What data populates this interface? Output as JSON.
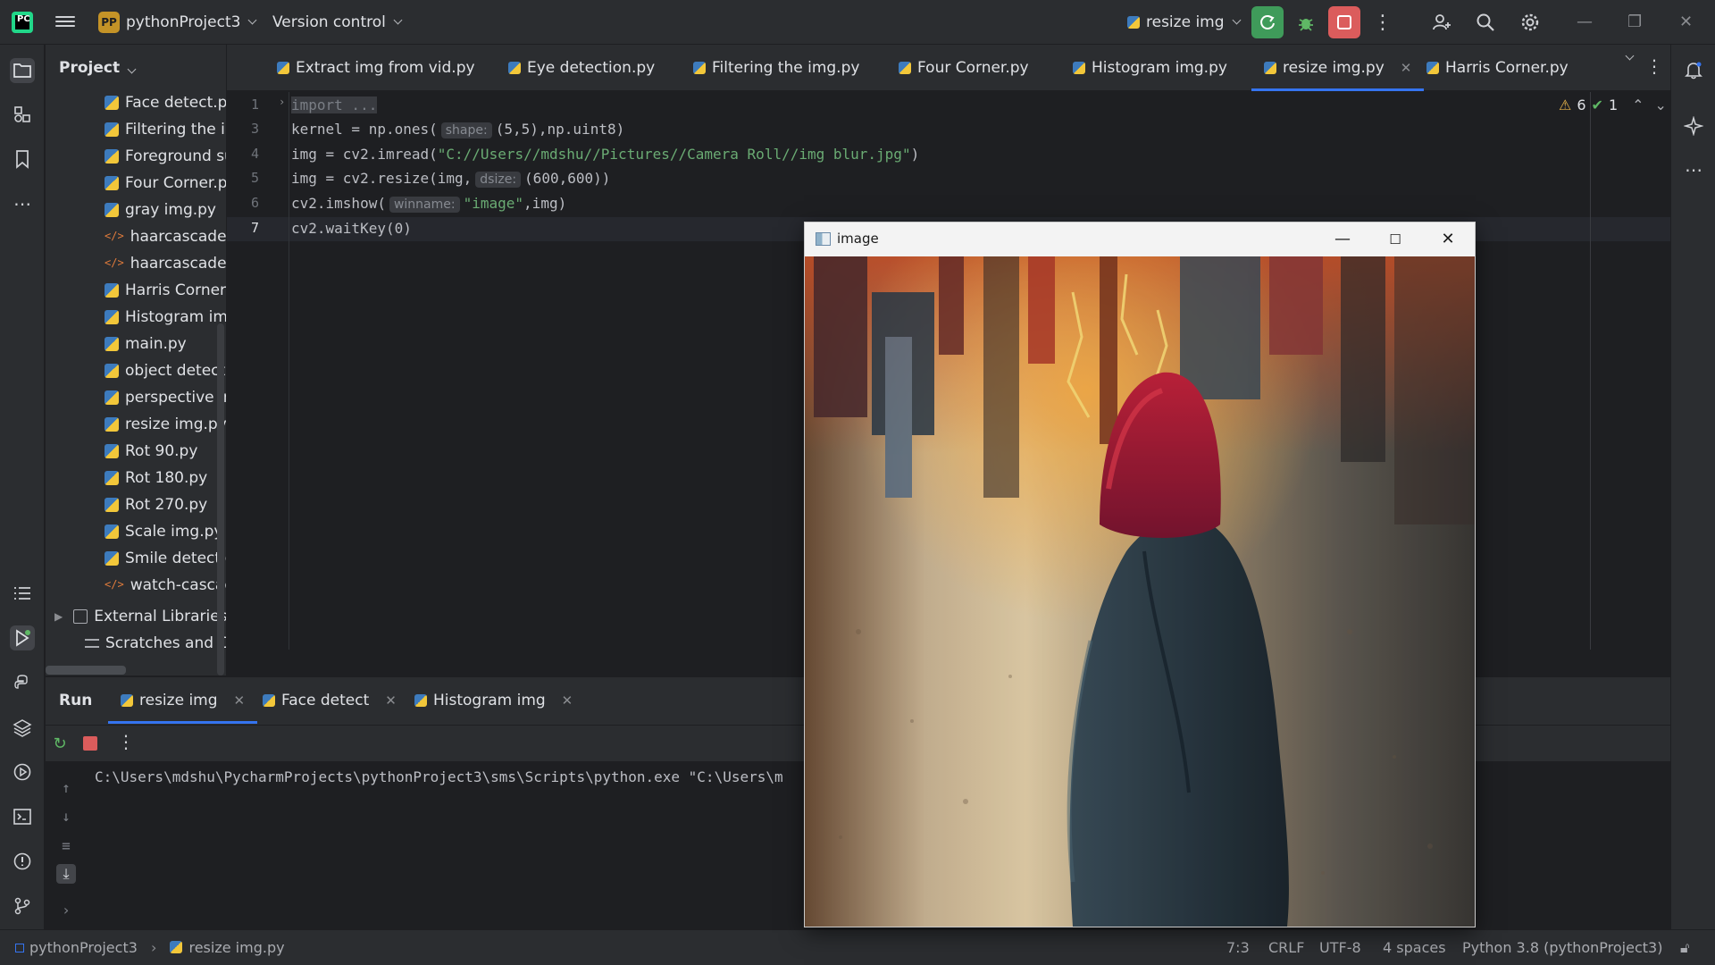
{
  "titlebar": {
    "logo_letters": "PC",
    "project_badge": "PP",
    "project_name": "pythonProject3",
    "vcs_label": "Version control",
    "run_config": "resize img"
  },
  "project_panel": {
    "header": "Project",
    "items": [
      {
        "label": "Face detect.py",
        "type": "py"
      },
      {
        "label": "Filtering the im",
        "type": "py"
      },
      {
        "label": "Foreground su",
        "type": "py"
      },
      {
        "label": "Four Corner.py",
        "type": "py"
      },
      {
        "label": "gray img.py",
        "type": "py"
      },
      {
        "label": "haarcascade_fr",
        "type": "xml"
      },
      {
        "label": "haarcascade_s",
        "type": "xml"
      },
      {
        "label": "Harris Corner.p",
        "type": "py"
      },
      {
        "label": "Histogram img",
        "type": "py"
      },
      {
        "label": "main.py",
        "type": "py"
      },
      {
        "label": "object detect.p",
        "type": "py"
      },
      {
        "label": "perspective im",
        "type": "py"
      },
      {
        "label": "resize img.py",
        "type": "py"
      },
      {
        "label": "Rot 90.py",
        "type": "py"
      },
      {
        "label": "Rot 180.py",
        "type": "py"
      },
      {
        "label": "Rot 270.py",
        "type": "py"
      },
      {
        "label": "Scale img.py",
        "type": "py"
      },
      {
        "label": "Smile detection",
        "type": "py"
      },
      {
        "label": "watch-cascade",
        "type": "xml"
      }
    ],
    "external_libraries": "External Libraries",
    "scratches": "Scratches and Co"
  },
  "tabs": [
    {
      "label": "Extract img from vid.py"
    },
    {
      "label": "Eye detection.py"
    },
    {
      "label": "Filtering the img.py"
    },
    {
      "label": "Four Corner.py"
    },
    {
      "label": "Histogram img.py"
    },
    {
      "label": "resize img.py",
      "active": true
    },
    {
      "label": "Harris Corner.py"
    }
  ],
  "editor": {
    "inspections": {
      "warnings": "6",
      "ok": "1"
    },
    "line_numbers": [
      "1",
      "3",
      "4",
      "5",
      "6",
      "7"
    ],
    "lines": {
      "l1": "import ...",
      "l3_a": "kernel = np.ones(",
      "l3_hint": "shape:",
      "l3_b": "(5,5),np.uint8)",
      "l4_a": "img = cv2.imread(",
      "l4_str": "\"C://Users//mdshu//Pictures//Camera Roll//img blur.jpg\"",
      "l4_b": ")",
      "l5_a": "img = cv2.resize(img,",
      "l5_hint": "dsize:",
      "l5_b": "(600,600))",
      "l6_a": "cv2.imshow(",
      "l6_hint": "winname:",
      "l6_str": "\"image\"",
      "l6_b": ",img)",
      "l7": "cv2.waitKey(0)"
    }
  },
  "run_panel": {
    "title": "Run",
    "tabs": [
      {
        "label": "resize img"
      },
      {
        "label": "Face detect"
      },
      {
        "label": "Histogram img"
      }
    ],
    "console_line": "C:\\Users\\mdshu\\PycharmProjects\\pythonProject3\\sms\\Scripts\\python.exe \"C:\\Users\\m"
  },
  "statusbar": {
    "breadcrumb_project": "pythonProject3",
    "breadcrumb_file": "resize img.py",
    "position": "7:3",
    "line_sep": "CRLF",
    "encoding": "UTF-8",
    "indent": "4 spaces",
    "interpreter": "Python 3.8 (pythonProject3)"
  },
  "image_window": {
    "title": "image"
  },
  "colors": {
    "accent": "#3574f0",
    "run_green": "#3f9b5a",
    "stop_red": "#db5c5c",
    "bg_editor": "#1e1f22",
    "bg_panel": "#2b2d30"
  }
}
